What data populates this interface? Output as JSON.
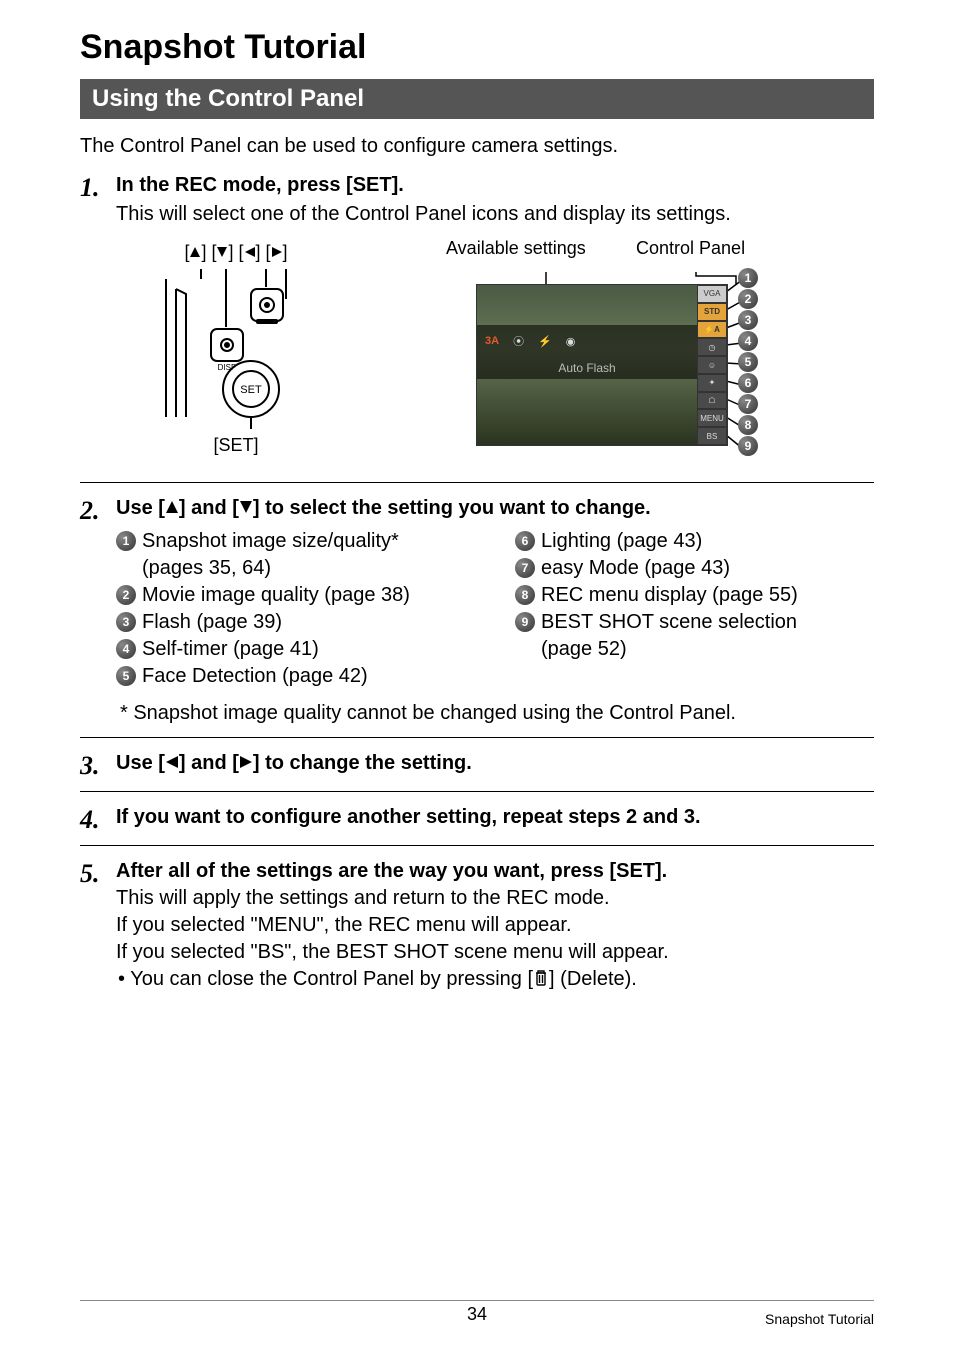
{
  "title": "Snapshot Tutorial",
  "section_heading": "Using the Control Panel",
  "intro": "The Control Panel can be used to configure camera settings.",
  "steps": {
    "s1": {
      "num": "1.",
      "title": "In the REC mode, press [SET].",
      "sub": "This will select one of the Control Panel icons and display its settings."
    },
    "s2": {
      "num": "2.",
      "title_before": "Use [",
      "title_mid": "] and [",
      "title_after": "] to select the setting you want to change."
    },
    "s3": {
      "num": "3.",
      "title_before": "Use [",
      "title_mid": "] and [",
      "title_after": "] to change the setting."
    },
    "s4": {
      "num": "4.",
      "title": "If you want to configure another setting, repeat steps 2 and 3."
    },
    "s5": {
      "num": "5.",
      "title": "After all of the settings are the way you want, press [SET].",
      "line1": "This will apply the settings and return to the REC mode.",
      "line2": "If you selected \"MENU\", the REC menu will appear.",
      "line3": "If you selected \"BS\", the BEST SHOT scene menu will appear.",
      "bullet_before": "• You can close the Control Panel by pressing [",
      "bullet_after": "] (Delete)."
    }
  },
  "diagram": {
    "arrows_label_prefix": "[",
    "arrows_label_sep": "] [",
    "arrows_label_suffix": "]",
    "set_label": "[SET]",
    "available_label": "Available settings",
    "cp_label": "Control Panel",
    "screen": {
      "red_text": "3A",
      "auto_flash": "Auto Flash",
      "cp_items": {
        "i1": "VGA",
        "i2": "STD",
        "i3": "⚡A",
        "i4": "◷",
        "i5": "☺",
        "i6": "✦",
        "i7": "☖",
        "i8": "MENU",
        "i9": "BS"
      }
    }
  },
  "list": {
    "l1": {
      "text": "Snapshot image size/quality*",
      "sub": "(pages 35, 64)"
    },
    "l2": {
      "text": "Movie image quality (page 38)"
    },
    "l3": {
      "text": "Flash (page 39)"
    },
    "l4": {
      "text": "Self-timer (page 41)"
    },
    "l5": {
      "text": "Face Detection (page 42)"
    },
    "l6": {
      "text": "Lighting (page 43)"
    },
    "l7": {
      "text": "easy Mode (page 43)"
    },
    "l8": {
      "text": "REC menu display (page 55)"
    },
    "l9": {
      "text": "BEST SHOT scene selection",
      "sub": "(page 52)"
    }
  },
  "footnote": "* Snapshot image quality cannot be changed using the Control Panel.",
  "footer": {
    "page": "34",
    "title": "Snapshot Tutorial"
  }
}
